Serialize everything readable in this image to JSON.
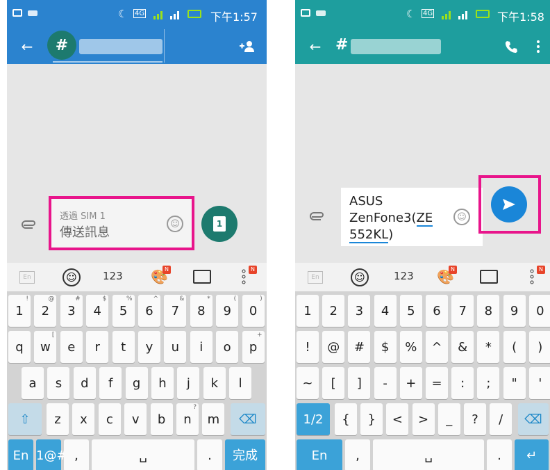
{
  "left": {
    "status": {
      "time": "下午1:57",
      "net": "4G"
    },
    "appbar": {
      "hash": "#",
      "title": "#"
    },
    "compose": {
      "hint_line1": "透過 SIM 1",
      "hint_line2": "傳送訊息",
      "sim_number": "1"
    },
    "suggest": {
      "lang": "En",
      "num_label": "123",
      "badge": "N"
    },
    "keys": {
      "row1": [
        "1",
        "2",
        "3",
        "4",
        "5",
        "6",
        "7",
        "8",
        "9",
        "0"
      ],
      "row1_hints": [
        "!",
        "@",
        "#",
        "$",
        "%",
        "^",
        "&",
        "*",
        "(",
        ")"
      ],
      "row2": [
        "q",
        "w",
        "e",
        "r",
        "t",
        "y",
        "u",
        "i",
        "o",
        "p"
      ],
      "row2_hints": [
        "",
        "[",
        "",
        "",
        "",
        "",
        "",
        "",
        "",
        "+"
      ],
      "row3": [
        "a",
        "s",
        "d",
        "f",
        "g",
        "h",
        "j",
        "k",
        "l"
      ],
      "row3_hints": [
        "",
        "",
        "",
        "",
        "",
        "",
        "",
        "",
        ""
      ],
      "row4": [
        "z",
        "x",
        "c",
        "v",
        "b",
        "n",
        "m"
      ],
      "row4_hints": [
        "",
        "",
        "",
        "",
        "",
        "?",
        ""
      ],
      "en": "En",
      "sym": "1@#",
      "comma": ",",
      "period": ".",
      "done": "完成"
    }
  },
  "right": {
    "status": {
      "time": "下午1:58",
      "net": "4G"
    },
    "appbar": {
      "hash": "#"
    },
    "compose": {
      "line1": "ASUS",
      "line2a": "ZenFone3(",
      "line2b": "ZE",
      "line3": "552KL",
      "line3b": ")"
    },
    "suggest": {
      "lang": "En",
      "num_label": "123",
      "badge": "N"
    },
    "keys": {
      "row1": [
        "1",
        "2",
        "3",
        "4",
        "5",
        "6",
        "7",
        "8",
        "9",
        "0"
      ],
      "row2": [
        "!",
        "@",
        "#",
        "$",
        "%",
        "^",
        "&",
        "*",
        "(",
        ")"
      ],
      "row3": [
        "~",
        "[",
        "]",
        "-",
        "+",
        "=",
        ":",
        ";",
        "\"",
        "'"
      ],
      "row4": [
        "{",
        "}",
        "<",
        ">",
        "_",
        "?",
        "/"
      ],
      "half": "1/2",
      "en": "En",
      "comma": ",",
      "period": "."
    }
  },
  "colors": {
    "left_bar": "#2b83cf",
    "right_bar": "#1e9e9e",
    "highlight": "#e8158b",
    "send_button": "#1a86d8",
    "sim_button": "#1d7a6e"
  }
}
